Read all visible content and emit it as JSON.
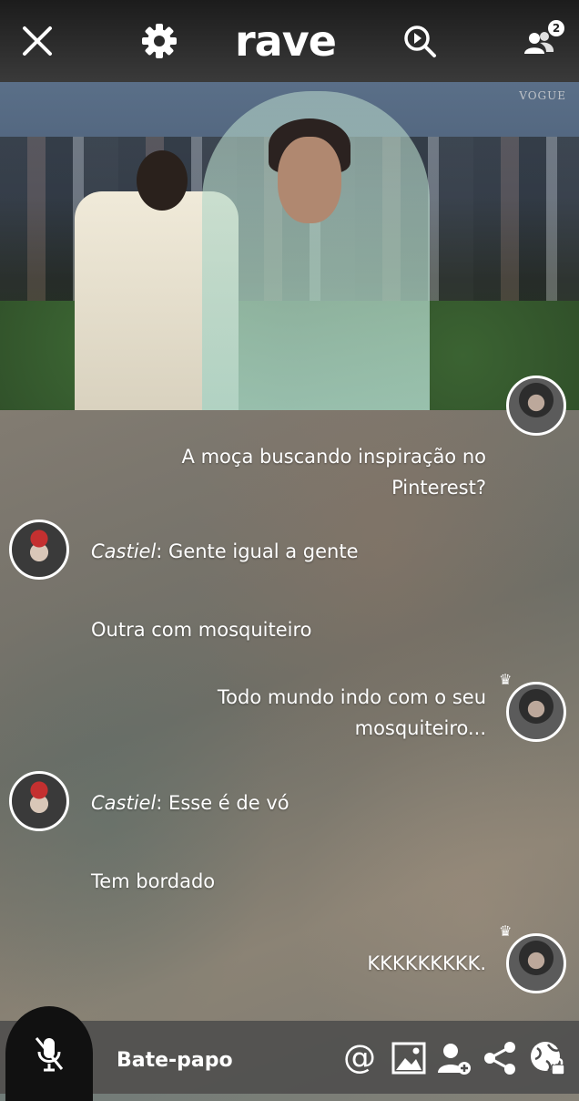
{
  "app": {
    "logo_text": "rave"
  },
  "header": {
    "close_icon": "close-icon",
    "settings_icon": "gear-icon",
    "search_icon": "search-play-icon",
    "users_icon": "users-icon",
    "users_count": "2"
  },
  "video": {
    "watermark": "VOGUE"
  },
  "chat": {
    "messages": [
      {
        "side": "right",
        "text_line1": "A moça buscando inspiração no",
        "text_line2": "Pinterest?"
      },
      {
        "side": "left",
        "author": "Castiel",
        "text": ": Gente igual a gente"
      },
      {
        "side": "left",
        "text": "Outra com mosquiteiro"
      },
      {
        "side": "right",
        "text_line1": "Todo mundo indo com o seu",
        "text_line2": "mosquiteiro..."
      },
      {
        "side": "left",
        "author": "Castiel",
        "text": ": Esse é de vó"
      },
      {
        "side": "left",
        "text": "Tem bordado"
      },
      {
        "side": "right",
        "text": "KKKKKKKKK."
      }
    ]
  },
  "footer": {
    "chat_label": "Bate-papo",
    "icons": [
      "mic-muted-icon",
      "at-icon",
      "image-icon",
      "add-user-icon",
      "share-icon",
      "globe-lock-icon"
    ]
  }
}
